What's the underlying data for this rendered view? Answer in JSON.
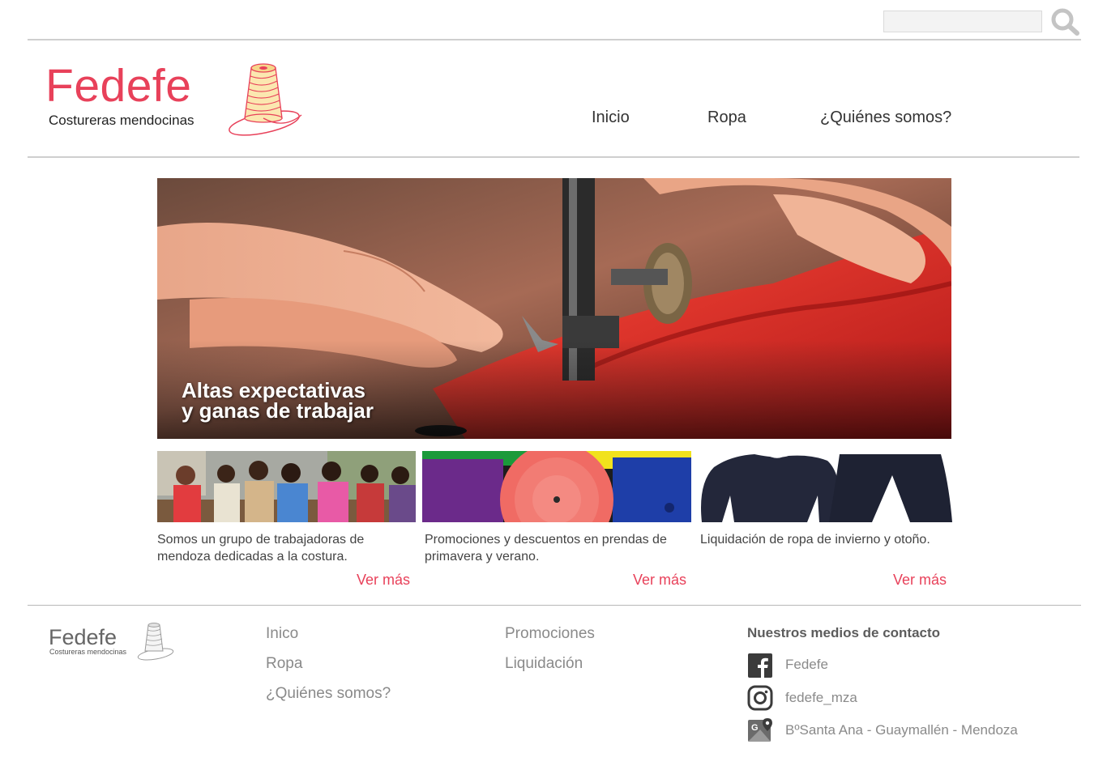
{
  "search": {
    "placeholder": "",
    "value": ""
  },
  "brand": {
    "name": "Fedefe",
    "tagline": "Costureras mendocinas",
    "accent_color": "#e8415a"
  },
  "nav": {
    "items": [
      {
        "label": "Inicio"
      },
      {
        "label": "Ropa"
      },
      {
        "label": "¿Quiénes somos?"
      }
    ]
  },
  "hero": {
    "line1": "Altas expectativas",
    "line2": "y ganas de trabajar"
  },
  "cards": [
    {
      "text": "Somos un grupo de trabajadoras de mendoza dedicadas a la costura.",
      "link": "Ver más",
      "image": "seamstresses-group-photo"
    },
    {
      "text": "Promociones y descuentos en prendas de primavera y verano.",
      "link": "Ver más",
      "image": "fabric-rolls-photo"
    },
    {
      "text": "Liquidación de ropa de invierno y otoño.",
      "link": "Ver más",
      "image": "winter-clothes-photo"
    }
  ],
  "footer": {
    "brand": {
      "name": "Fedefe",
      "tagline": "Costureras mendocinas"
    },
    "col1": [
      {
        "label": "Inico"
      },
      {
        "label": "Ropa"
      },
      {
        "label": "¿Quiénes somos?"
      }
    ],
    "col2": [
      {
        "label": "Promociones"
      },
      {
        "label": "Liquidación"
      }
    ],
    "contact": {
      "heading": "Nuestros medios de contacto",
      "items": [
        {
          "icon": "facebook-icon",
          "text": "Fedefe"
        },
        {
          "icon": "instagram-icon",
          "text": "fedefe_mza"
        },
        {
          "icon": "maps-icon",
          "text": "BºSanta Ana - Guaymallén - Mendoza"
        }
      ]
    }
  }
}
